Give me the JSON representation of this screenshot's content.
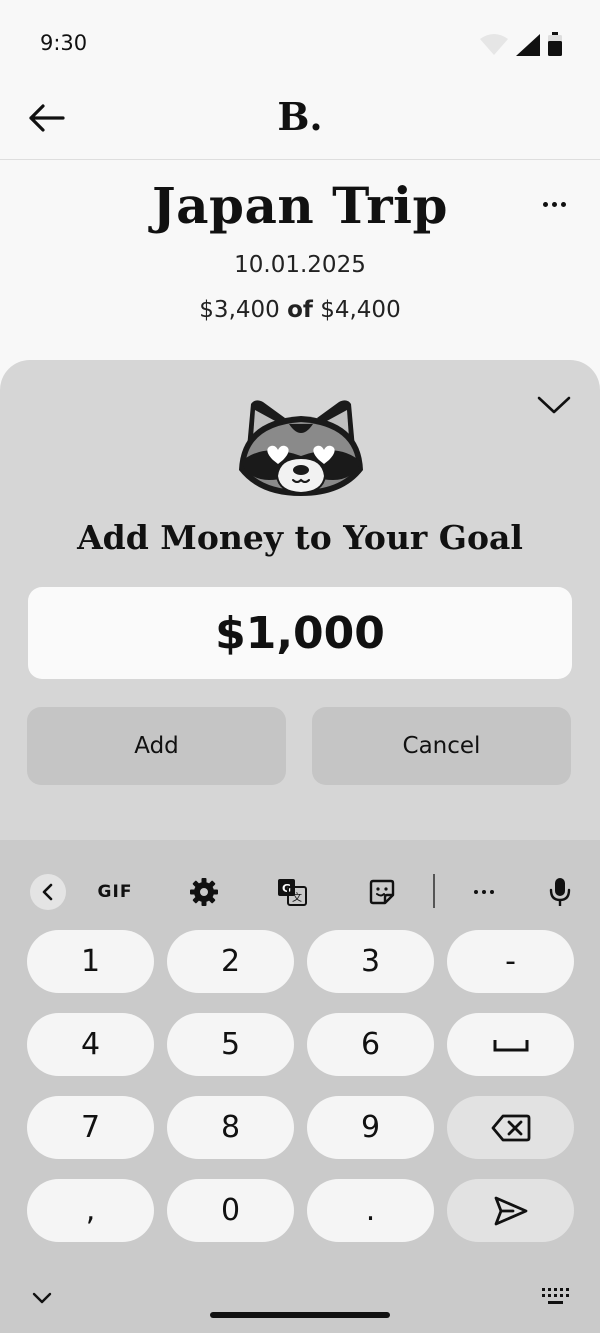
{
  "status_bar": {
    "time": "9:30",
    "icons": [
      "wifi-icon",
      "cell-signal-icon",
      "battery-icon"
    ]
  },
  "app_bar": {
    "brand": "B.",
    "back_icon": "arrow-left-icon"
  },
  "goal": {
    "title": "Japan Trip",
    "date": "10.01.2025",
    "saved": "$3,400",
    "of_word": "of",
    "target": "$4,400",
    "more_icon": "more-horizontal-icon"
  },
  "sheet": {
    "collapse_icon": "chevron-down-icon",
    "mascot_icon": "raccoon-heart-eyes-icon",
    "title": "Add Money to Your Goal",
    "amount_value": "$1,000",
    "add_label": "Add",
    "cancel_label": "Cancel"
  },
  "keyboard": {
    "toolbar": {
      "gif_label": "GIF",
      "icons": [
        "chevron-left-icon",
        "gear-icon",
        "translate-icon",
        "sticker-icon",
        "more-horizontal-icon",
        "mic-icon"
      ]
    },
    "keys": {
      "k1": "1",
      "k2": "2",
      "k3": "3",
      "dash": "-",
      "k4": "4",
      "k5": "5",
      "k6": "6",
      "k7": "7",
      "k8": "8",
      "k9": "9",
      "comma": ",",
      "k0": "0",
      "period": "."
    },
    "special_icons": [
      "space-icon",
      "backspace-icon",
      "send-icon",
      "chevron-down-icon",
      "keyboard-switch-icon"
    ]
  },
  "colors": {
    "background": "#f8f8f8",
    "sheet": "#d6d6d6",
    "button": "#c5c5c5",
    "keyboard": "#cacaca",
    "key": "#f5f5f5",
    "text": "#111111"
  }
}
